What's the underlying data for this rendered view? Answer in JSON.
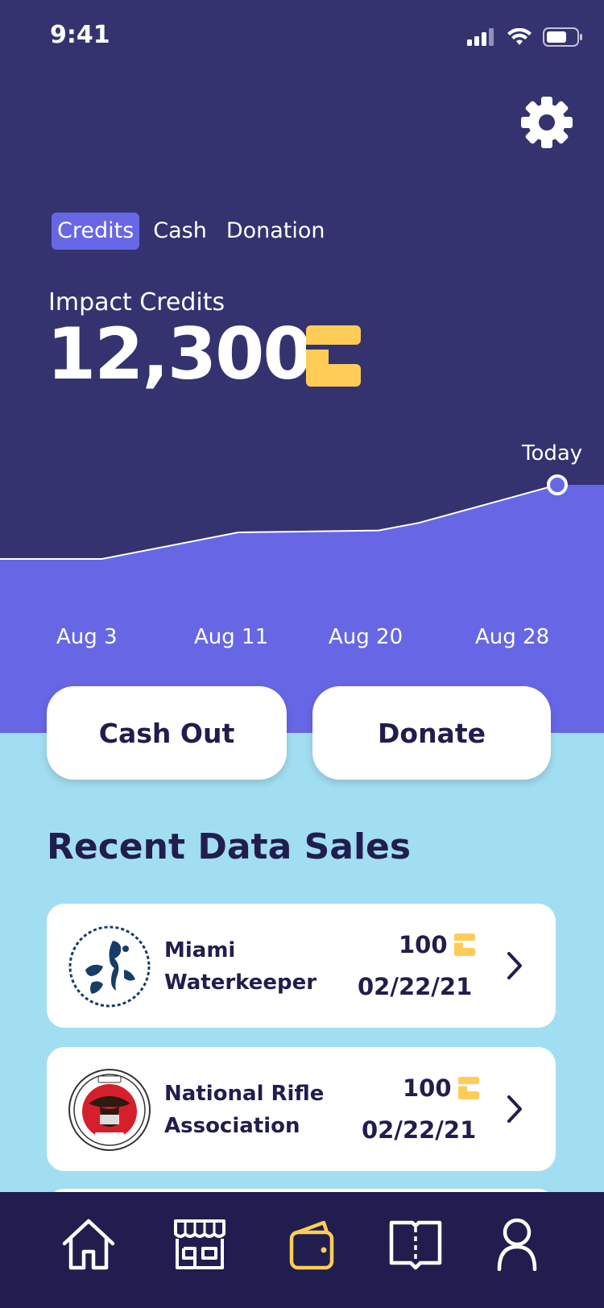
{
  "status": {
    "time": "9:41"
  },
  "tabs": [
    {
      "label": "Credits",
      "active": true
    },
    {
      "label": "Cash",
      "active": false
    },
    {
      "label": "Donation",
      "active": false
    }
  ],
  "balance": {
    "label": "Impact Credits",
    "value": "12,300"
  },
  "chart_data": {
    "type": "area",
    "categories": [
      "Aug 3",
      "Aug 11",
      "Aug 20",
      "Aug 28"
    ],
    "marker_label": "Today",
    "x": [
      0,
      1,
      2,
      3,
      4,
      5
    ],
    "values": [
      0.22,
      0.22,
      0.5,
      0.52,
      0.6,
      1.0
    ],
    "ylim": [
      0,
      1
    ]
  },
  "actions": {
    "cash_out": "Cash Out",
    "donate": "Donate"
  },
  "recent": {
    "title": "Recent Data Sales",
    "items": [
      {
        "org_line1": "Miami",
        "org_line2": "Waterkeeper",
        "amount": "100",
        "date": "02/22/21",
        "logo": "seahorse-logo"
      },
      {
        "org_line1": "National Rifle",
        "org_line2": "Association",
        "amount": "100",
        "date": "02/22/21",
        "logo": "nra-seal-logo"
      }
    ]
  },
  "nav": [
    "home-icon",
    "store-icon",
    "wallet-icon",
    "book-icon",
    "profile-icon"
  ],
  "colors": {
    "bg_dark": "#34336f",
    "accent": "#6767e6",
    "credit_yellow": "#ffcd57",
    "light_blue": "#a2def1",
    "navy": "#211d4f"
  }
}
